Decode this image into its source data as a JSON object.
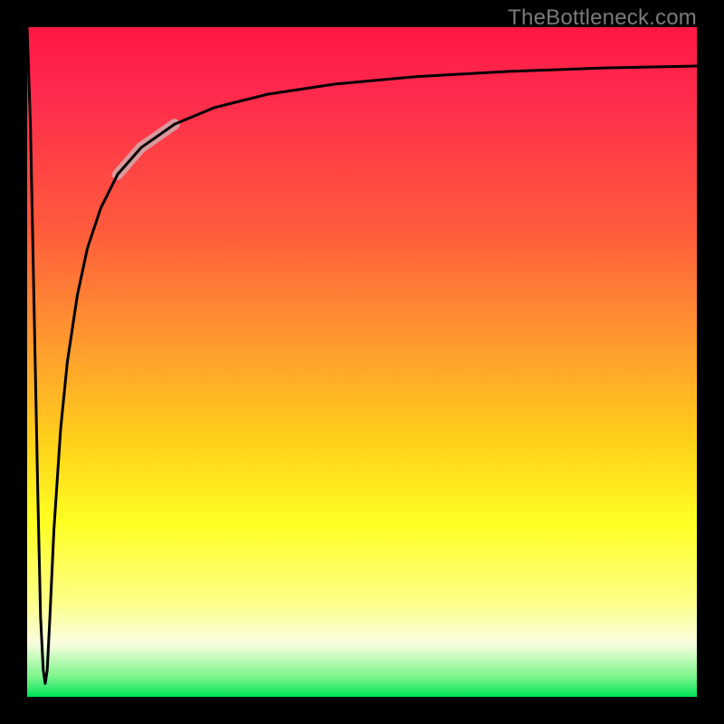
{
  "watermark": {
    "text": "TheBottleneck.com"
  },
  "chart_data": {
    "type": "line",
    "title": "",
    "xlabel": "",
    "ylabel": "",
    "xlim": [
      0,
      100
    ],
    "ylim": [
      0,
      100
    ],
    "grid": false,
    "legend": false,
    "background_gradient": {
      "direction": "vertical",
      "stops": [
        {
          "pos": 0.0,
          "color": "#ff1744"
        },
        {
          "pos": 0.3,
          "color": "#ff5a3c"
        },
        {
          "pos": 0.48,
          "color": "#ff9d2e"
        },
        {
          "pos": 0.62,
          "color": "#ffd11a"
        },
        {
          "pos": 0.74,
          "color": "#ffff22"
        },
        {
          "pos": 0.92,
          "color": "#fafde0"
        },
        {
          "pos": 1.0,
          "color": "#00e35a"
        }
      ]
    },
    "series": [
      {
        "name": "curve",
        "color": "#000000",
        "stroke_width": 3,
        "x": [
          0.0,
          0.5,
          1.0,
          1.6,
          2.0,
          2.4,
          2.7,
          3.0,
          3.4,
          4.0,
          5.0,
          6.0,
          7.5,
          9.0,
          11.0,
          13.5,
          17.0,
          22.0,
          28.0,
          36.0,
          46.0,
          58.0,
          72.0,
          86.0,
          100.0
        ],
        "y": [
          100,
          85,
          60,
          30,
          12,
          4,
          2,
          4,
          12,
          25,
          40,
          50,
          60,
          67,
          73,
          78,
          82,
          85.5,
          88,
          90,
          91.5,
          92.6,
          93.4,
          93.9,
          94.2
        ]
      }
    ],
    "annotations": [
      {
        "name": "highlight-segment",
        "color": "#d6a3a6",
        "opacity": 0.9,
        "stroke_width": 12,
        "x": [
          13.5,
          17.0,
          22.0
        ],
        "y": [
          78.0,
          82.0,
          85.5
        ]
      }
    ]
  }
}
